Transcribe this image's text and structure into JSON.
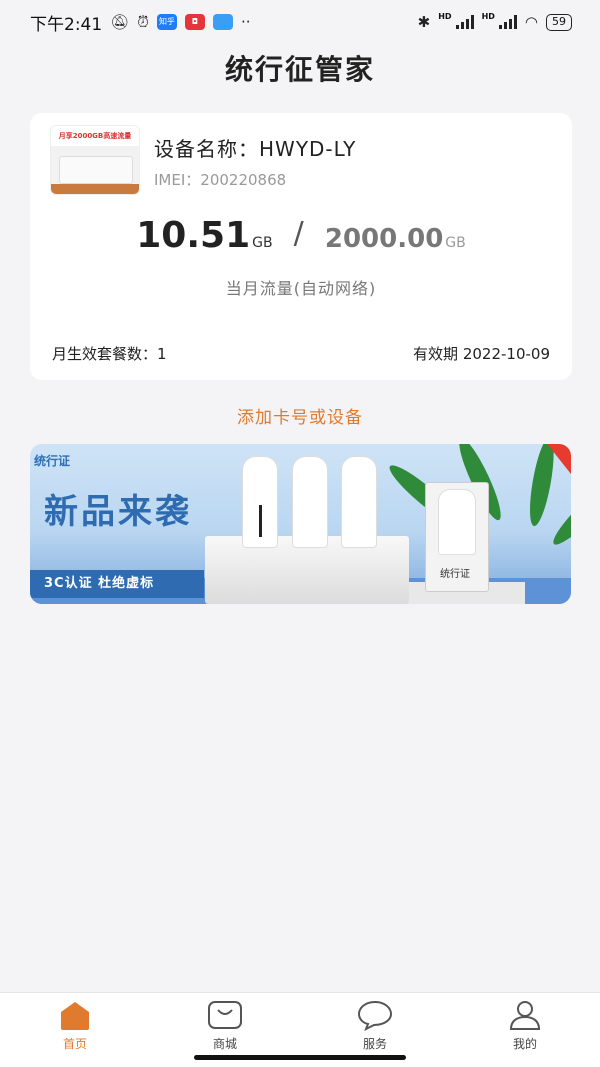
{
  "status_bar": {
    "time": "下午2:41",
    "battery": "59",
    "app_badges": [
      "知乎",
      "◘"
    ]
  },
  "app_title": "统行征管家",
  "device_card": {
    "thumb_text": "月享2000GB高速流量",
    "device_name_label": "设备名称：",
    "device_name": "HWYD-LY",
    "imei_label": "IMEI：",
    "imei": "200220868",
    "used_value": "10.51",
    "used_unit": "GB",
    "separator": "/",
    "total_value": "2000.00",
    "total_unit": "GB",
    "usage_caption": "当月流量(自动网络)",
    "plans_label": "月生效套餐数：",
    "plans_count": "1",
    "valid_label": "有效期",
    "valid_date": "2022-10-09"
  },
  "add_link": "添加卡号或设备",
  "banner": {
    "logo": "统行证",
    "headline": "新品来袭",
    "tagline": "3C认证  杜绝虚标",
    "box_label": "统行证"
  },
  "bottom_nav": {
    "items": [
      {
        "label": "首页",
        "active": true
      },
      {
        "label": "商城",
        "active": false
      },
      {
        "label": "服务",
        "active": false
      },
      {
        "label": "我的",
        "active": false
      }
    ]
  },
  "colors": {
    "accent": "#e07a2e",
    "banner_blue": "#2e6bb0"
  }
}
